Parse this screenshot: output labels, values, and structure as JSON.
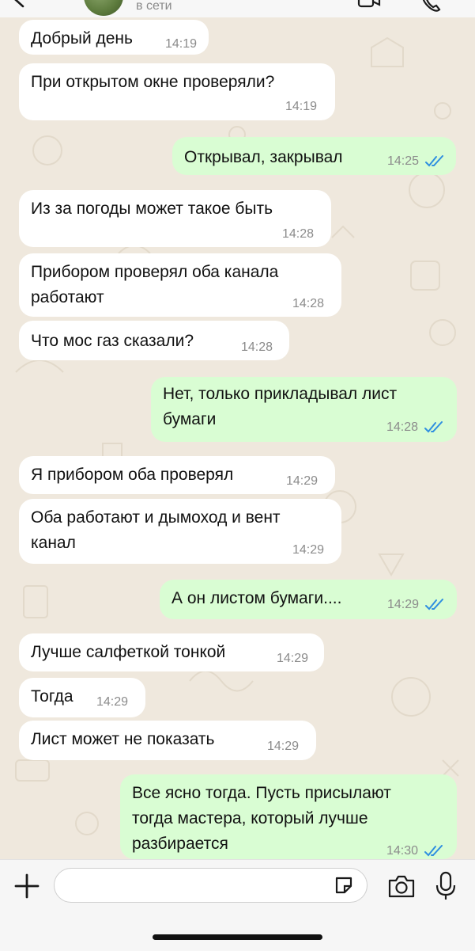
{
  "header": {
    "status": "в сети"
  },
  "messages": [
    {
      "dir": "in",
      "lines": [
        "Добрый день"
      ],
      "time": "14:19"
    },
    {
      "dir": "in",
      "lines": [
        "При открытом окне проверяли?"
      ],
      "time": "14:19"
    },
    {
      "dir": "out",
      "lines": [
        "Открывал, закрывал"
      ],
      "time": "14:25",
      "read": true
    },
    {
      "dir": "in",
      "lines": [
        "Из за погоды может такое быть"
      ],
      "time": "14:28"
    },
    {
      "dir": "in",
      "lines": [
        "Прибором проверял оба канала",
        "работают"
      ],
      "time": "14:28"
    },
    {
      "dir": "in",
      "lines": [
        "Что мос газ сказали?"
      ],
      "time": "14:28"
    },
    {
      "dir": "out",
      "lines": [
        "Нет, только прикладывал лист",
        "бумаги"
      ],
      "time": "14:28",
      "read": true
    },
    {
      "dir": "in",
      "lines": [
        "Я прибором оба проверял"
      ],
      "time": "14:29"
    },
    {
      "dir": "in",
      "lines": [
        "Оба работают и дымоход и вент",
        "канал"
      ],
      "time": "14:29"
    },
    {
      "dir": "out",
      "lines": [
        "А он листом бумаги...."
      ],
      "time": "14:29",
      "read": true
    },
    {
      "dir": "in",
      "lines": [
        "Лучше салфеткой тонкой"
      ],
      "time": "14:29"
    },
    {
      "dir": "in",
      "lines": [
        "Тогда"
      ],
      "time": "14:29"
    },
    {
      "dir": "in",
      "lines": [
        "Лист может не показать"
      ],
      "time": "14:29"
    },
    {
      "dir": "out",
      "lines": [
        "Все ясно тогда. Пусть присылают",
        "тогда мастера, который лучше",
        "разбирается"
      ],
      "time": "14:30",
      "read": true
    }
  ],
  "input": {
    "placeholder": ""
  },
  "icons": {
    "back": "chevron-left-icon",
    "video": "video-icon",
    "call": "phone-icon",
    "attach": "plus-icon",
    "sticker": "sticker-icon",
    "camera": "camera-icon",
    "mic": "microphone-icon"
  },
  "colors": {
    "incoming": "#ffffff",
    "outgoing": "#d9fdd3",
    "read_ticks": "#2f8fe0",
    "wallpaper": "#efe8dd"
  }
}
